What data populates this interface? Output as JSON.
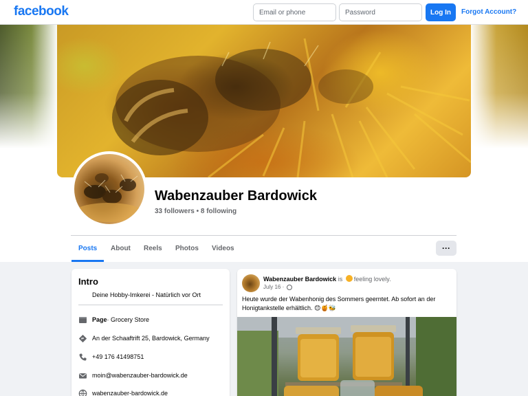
{
  "brand": {
    "logo_text": "facebook",
    "color": "#1877f2"
  },
  "login": {
    "email_placeholder": "Email or phone",
    "password_placeholder": "Password",
    "login_label": "Log In",
    "forgot_label": "Forgot Account?"
  },
  "profile": {
    "name": "Wabenzauber Bardowick",
    "stats": "33 followers • 8 following"
  },
  "tabs": [
    {
      "label": "Posts",
      "active": true
    },
    {
      "label": "About",
      "active": false
    },
    {
      "label": "Reels",
      "active": false
    },
    {
      "label": "Photos",
      "active": false
    },
    {
      "label": "Videos",
      "active": false
    }
  ],
  "more_label": "···",
  "intro": {
    "title": "Intro",
    "bio": "Deine Hobby-Imkerei - Natürlich vor Ort",
    "category_label": "Page",
    "category_value": " · Grocery Store",
    "address": "An der Schaaftrift 25, Bardowick, Germany",
    "phone": "+49 176 41498751",
    "email": "moin@wabenzauber-bardowick.de",
    "website": "wabenzauber-bardowick.de"
  },
  "post": {
    "author": "Wabenzauber Bardowick",
    "activity_prefix": " is ",
    "activity": "feeling lovely.",
    "date": "July 16 · ",
    "text": "Heute wurde der Wabenhonig des Sommers geerntet.  Ab sofort an der Honigtankstelle erhältlich.  😊🍯🐝"
  }
}
